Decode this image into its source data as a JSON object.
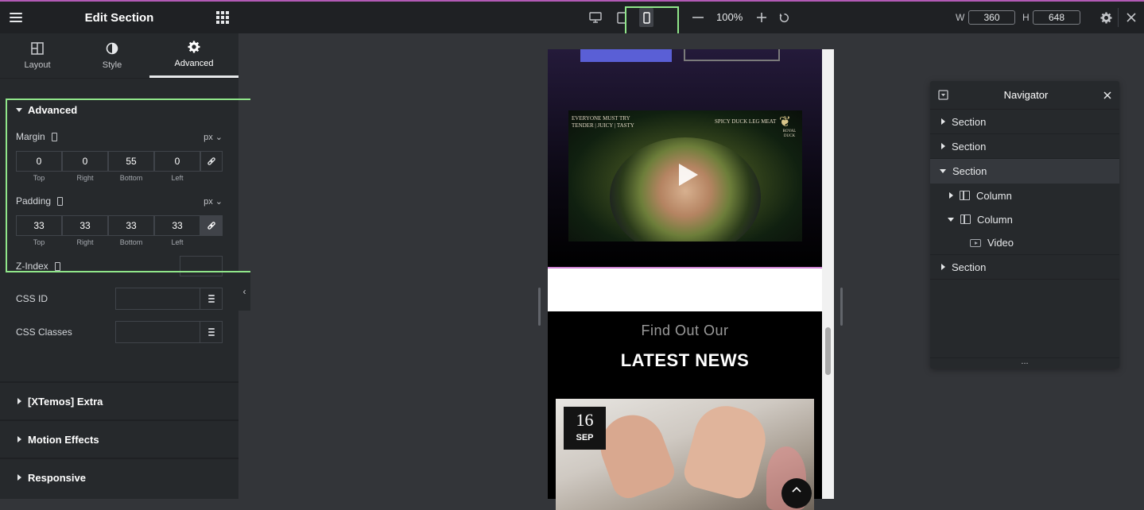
{
  "panel": {
    "title": "Edit Section",
    "tabs": [
      {
        "label": "Layout"
      },
      {
        "label": "Style"
      },
      {
        "label": "Advanced"
      }
    ],
    "active_tab": "Advanced",
    "section_title": "Advanced",
    "margin": {
      "label": "Margin",
      "unit": "px",
      "values": [
        "0",
        "0",
        "55",
        "0"
      ],
      "labels": [
        "Top",
        "Right",
        "Bottom",
        "Left"
      ],
      "linked": false
    },
    "padding": {
      "label": "Padding",
      "unit": "px",
      "values": [
        "33",
        "33",
        "33",
        "33"
      ],
      "labels": [
        "Top",
        "Right",
        "Bottom",
        "Left"
      ],
      "linked": true
    },
    "z_index": {
      "label": "Z-Index",
      "value": ""
    },
    "css_id": {
      "label": "CSS ID",
      "value": ""
    },
    "css_classes": {
      "label": "CSS Classes",
      "value": ""
    },
    "accordions": [
      {
        "label": "[XTemos] Extra"
      },
      {
        "label": "Motion Effects"
      },
      {
        "label": "Responsive"
      }
    ]
  },
  "topbar": {
    "zoom": "100%",
    "width_label": "W",
    "width_value": "360",
    "height_label": "H",
    "height_value": "648",
    "active_device": "mobile"
  },
  "preview": {
    "video_text_left_1": "EVERYONE MUST TRY",
    "video_text_left_2": "TENDER | JUICY | TASTY",
    "video_text_right": "SPICY DUCK LEG MEAT",
    "video_logo_text": "ROYAL DUCK",
    "news_subtitle": "Find Out Our",
    "news_title": "LATEST NEWS",
    "date_day": "16",
    "date_month": "SEP"
  },
  "navigator": {
    "title": "Navigator",
    "items": [
      {
        "label": "Section"
      },
      {
        "label": "Section"
      },
      {
        "label": "Section"
      },
      {
        "label": "Column"
      },
      {
        "label": "Column"
      },
      {
        "label": "Video"
      },
      {
        "label": "Section"
      }
    ],
    "footer": "..."
  },
  "colors": {
    "highlight": "#90e68a",
    "panel_bg": "#26292c",
    "topbar_bg": "#1f2124",
    "accent_line": "#b25ab5"
  }
}
